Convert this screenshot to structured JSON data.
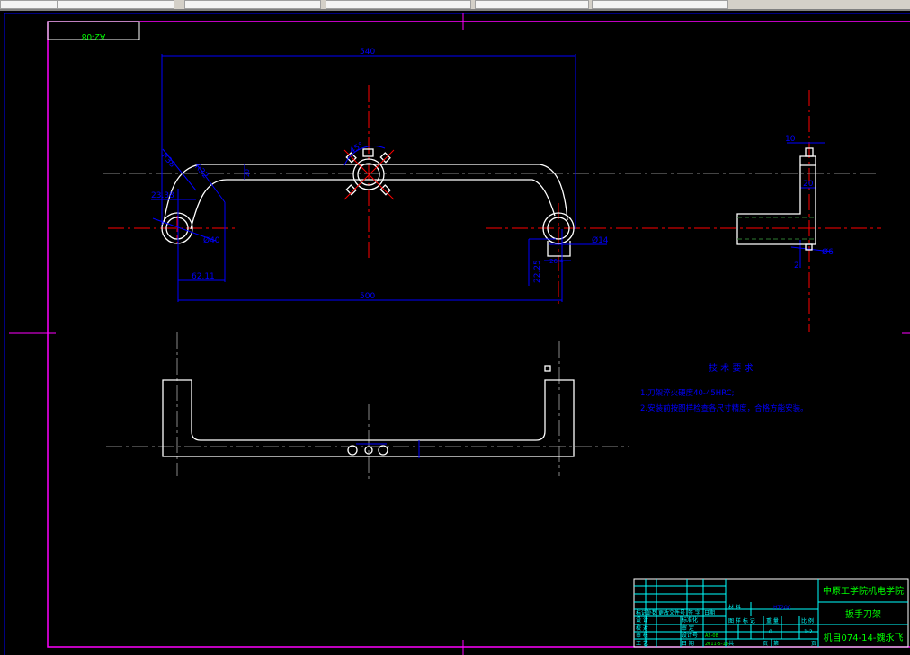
{
  "toolbar": {
    "items": [
      "",
      "",
      "",
      "",
      "",
      ""
    ]
  },
  "colors": {
    "background": "#000000",
    "frame": "#ff00ff",
    "outline": "#ffffff",
    "dimension": "#0000ff",
    "centerline": "#ff0000",
    "titleblock": "#00ffff",
    "title_text": "#00ff00"
  },
  "drawing": {
    "sheet_code": "A2-08",
    "dims": {
      "width_top": "540",
      "width_centers": "500",
      "r_outer": "R38",
      "r_inner": "R32",
      "bar_thickness": "20",
      "offset": "23.38",
      "offset_x": "62.11",
      "hole_dia": "Ø40",
      "angle": "45°",
      "slot_dia": "Ø14",
      "slot_width": "26.4",
      "slot_depth": "22.25",
      "side_top": "10",
      "side_width": "20",
      "side_hole": "Ø6",
      "side_gap": "2"
    },
    "tech_req": {
      "title": "技 术 要 求",
      "lines": [
        "1.刀架淬火硬度40-45HRC;",
        "2.安装前按图样检查各尺寸精度，合格方能安装。"
      ]
    }
  },
  "title_block": {
    "school": "中原工学院机电学院",
    "part_name": "扳手刀架",
    "drawing_no": "机自074-14-魏永飞",
    "material": "HT200",
    "material_label": "材 料",
    "cols": [
      "图 样 标 记",
      "重 量",
      "比 例"
    ],
    "weight": "0",
    "scale": "1:2",
    "sheet": [
      "共",
      "页",
      "第",
      "页"
    ],
    "rev_headers": [
      "标记",
      "处数",
      "更改文件号",
      "签",
      "字",
      "日期"
    ],
    "roles": [
      "设 计",
      "校 对",
      "审 核",
      "工 艺"
    ],
    "roles2": [
      "标准化",
      "审 定",
      "设计号",
      "日 期"
    ],
    "code": "A2-08",
    "date": "2011-5-18"
  }
}
